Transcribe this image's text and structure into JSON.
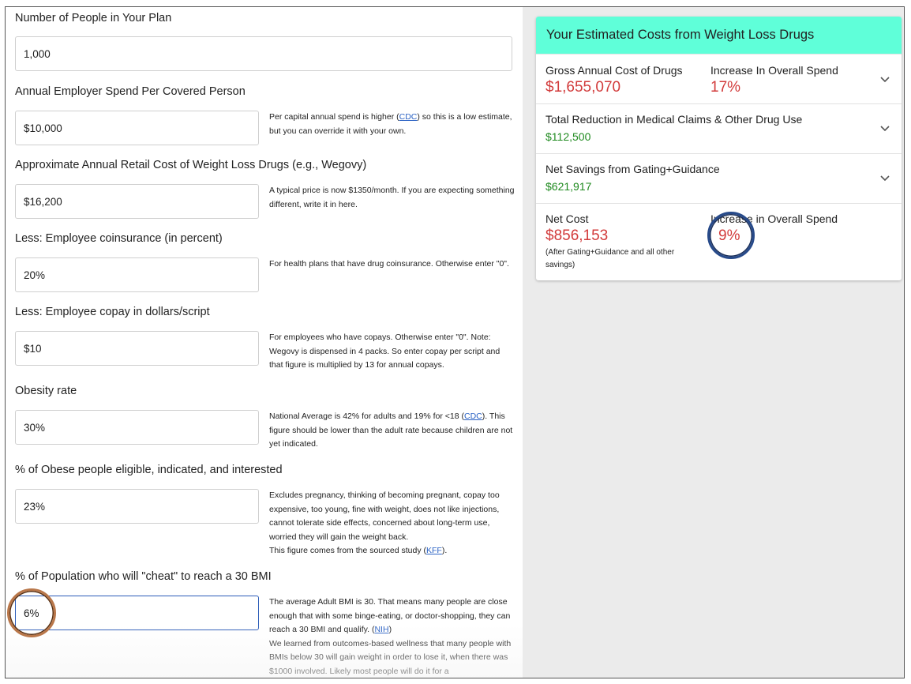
{
  "form": {
    "people_label": "Number of People in Your Plan",
    "people_value": "1,000",
    "spend_label": "Annual Employer Spend Per Covered Person",
    "spend_value": "$10,000",
    "spend_note_pre": "Per capital annual spend is higher (",
    "spend_note_link": "CDC",
    "spend_note_post": ") so this is a low estimate, but you can override it with your own.",
    "drug_label": "Approximate Annual Retail Cost of Weight Loss Drugs (e.g., Wegovy)",
    "drug_value": "$16,200",
    "drug_note": "A typical price is now $1350/month. If you are expecting something different, write it in here.",
    "coins_label": "Less: Employee coinsurance (in percent)",
    "coins_value": "20%",
    "coins_note": "For health plans that have drug coinsurance. Otherwise enter \"0\".",
    "copay_label": "Less: Employee copay in dollars/script",
    "copay_value": "$10",
    "copay_note": "For employees who have copays. Otherwise enter \"0\". Note: Wegovy is dispensed in 4 packs. So enter copay per script and that figure is multiplied by 13 for annual copays.",
    "obesity_label": "Obesity rate",
    "obesity_value": "30%",
    "obesity_note_pre": "National Average is 42% for adults and 19% for <18 (",
    "obesity_note_link": "CDC",
    "obesity_note_post": "). This figure should be lower than the adult rate because children are not yet indicated.",
    "eligible_label": "% of Obese people eligible, indicated, and interested",
    "eligible_value": "23%",
    "eligible_note": "Excludes pregnancy, thinking of becoming pregnant, copay too expensive, too young, fine with weight, does not like injections, cannot tolerate side effects, concerned about long-term use, worried they will gain the weight back.",
    "eligible_note2_pre": "This figure comes from the sourced study (",
    "eligible_note2_link": "KFF",
    "eligible_note2_post": ").",
    "cheat_label": "% of Population who will \"cheat\" to reach a 30 BMI",
    "cheat_value": "6%",
    "cheat_note_pre": "The average Adult BMI is 30. That means many people are close enough that with some binge-eating, or doctor-shopping, they can reach a 30 BMI and qualify. (",
    "cheat_note_link": "NIH",
    "cheat_note_post": ")",
    "cheat_note2": "We learned from outcomes-based wellness that many people with BMIs below 30 will gain weight in order to lose it, when there was $1000 involved. Likely most people will do it for a"
  },
  "results": {
    "header": "Your Estimated Costs from Weight Loss Drugs",
    "gross_label": "Gross Annual Cost of Drugs",
    "gross_value": "$1,655,070",
    "increase_label": "Increase In Overall Spend",
    "increase_value": "17%",
    "reduction_label": "Total Reduction in Medical Claims & Other Drug Use",
    "reduction_value": "$112,500",
    "savings_label": "Net Savings from Gating+Guidance",
    "savings_value": "$621,917",
    "net_label": "Net Cost",
    "net_value": "$856,153",
    "net_note": "(After Gating+Guidance and all other savings)",
    "net_increase_label": "Increase in Overall Spend",
    "net_increase_value": "9%"
  },
  "colors": {
    "header_bg": "#5fffd9",
    "red": "#d23b3b",
    "green": "#1f8a1f",
    "link": "#2b62c4",
    "focus": "#2c5cb8"
  }
}
